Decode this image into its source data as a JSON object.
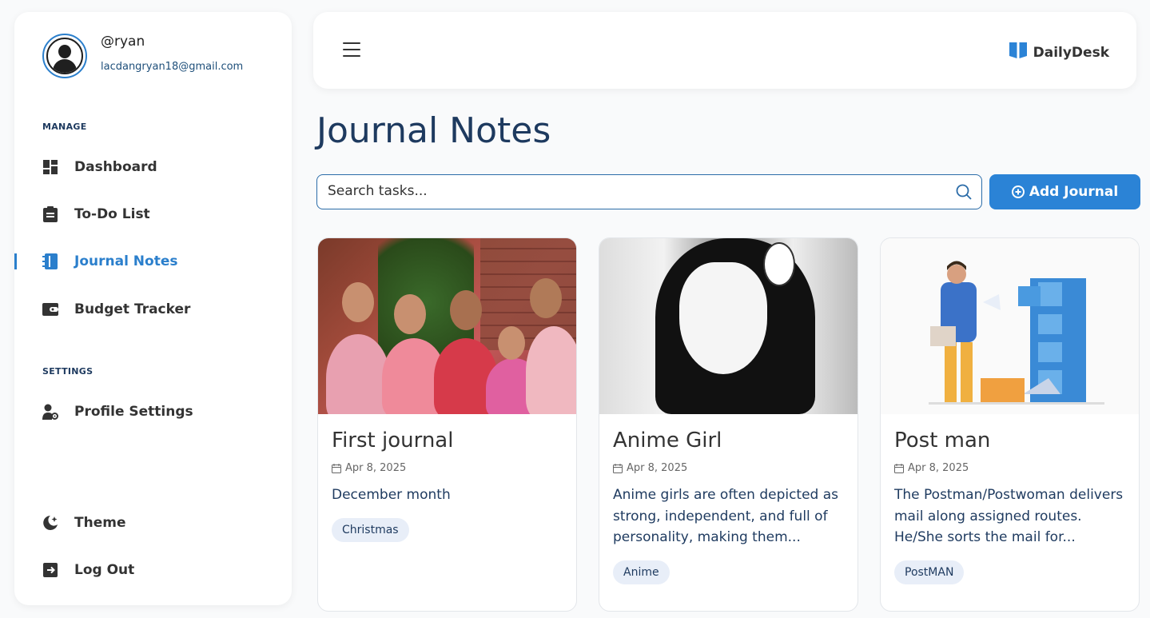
{
  "user": {
    "handle": "@ryan",
    "email": "lacdangryan18@gmail.com"
  },
  "sidebar": {
    "manage_label": "MANAGE",
    "settings_label": "SETTINGS",
    "items": [
      {
        "label": "Dashboard",
        "icon": "dashboard-icon"
      },
      {
        "label": "To-Do List",
        "icon": "clipboard-icon"
      },
      {
        "label": "Journal Notes",
        "icon": "notebook-icon",
        "active": true
      },
      {
        "label": "Budget Tracker",
        "icon": "wallet-icon"
      },
      {
        "label": "Profile Settings",
        "icon": "user-gear-icon"
      },
      {
        "label": "Theme",
        "icon": "moon-icon"
      },
      {
        "label": "Log Out",
        "icon": "logout-icon"
      }
    ]
  },
  "header": {
    "brand": "DailyDesk",
    "menu_icon": "hamburger-icon"
  },
  "main": {
    "title": "Journal Notes",
    "search": {
      "placeholder": "Search tasks...",
      "value": ""
    },
    "add_button": "Add Journal",
    "cards": [
      {
        "title": "First journal",
        "date": "Apr 8, 2025",
        "description": "December month",
        "tag": "Christmas"
      },
      {
        "title": "Anime Girl",
        "date": "Apr 8, 2025",
        "description": "Anime girls are often depicted as strong, independent, and full of personality, making them...",
        "tag": "Anime"
      },
      {
        "title": "Post man",
        "date": "Apr 8, 2025",
        "description": "The Postman/Postwoman delivers mail along assigned routes. He/She sorts the mail for...",
        "tag": "PostMAN"
      }
    ]
  },
  "colors": {
    "accent": "#2b83d6",
    "title": "#1e3a5f"
  }
}
